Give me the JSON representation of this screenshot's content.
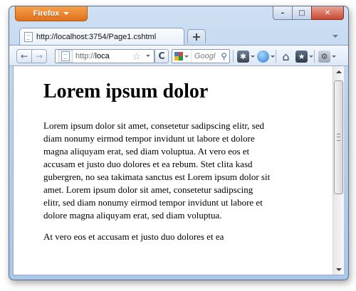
{
  "titlebar": {
    "app_menu_label": "Firefox",
    "minimize_glyph": "–",
    "maximize_glyph": "□",
    "close_glyph": "✕"
  },
  "tabs": [
    {
      "title": "http://localhost:3754/Page1.cshtml",
      "icon": "page-icon"
    }
  ],
  "new_tab_glyph": "+",
  "navigation": {
    "back_glyph": "←",
    "forward_glyph": "→",
    "url_host": "http://",
    "url_path": "loca",
    "reload_glyph": "C",
    "bookmark_star_glyph": "☆"
  },
  "search": {
    "placeholder": "Googl",
    "engine_icon": "google-icon",
    "go_glyph": "⚲"
  },
  "toolbar_icons": [
    "addon-bar-icon",
    "globe-icon",
    "home-icon",
    "bookmarks-icon",
    "extension-icon"
  ],
  "page": {
    "heading": "Lorem ipsum dolor",
    "paragraph1": "Lorem ipsum dolor sit amet, consetetur sadipscing elitr, sed diam nonumy eirmod tempor invidunt ut labore et dolore magna aliquyam erat, sed diam voluptua. At vero eos et accusam et justo duo dolores et ea rebum. Stet clita kasd gubergren, no sea takimata sanctus est Lorem ipsum dolor sit amet. Lorem ipsum dolor sit amet, consetetur sadipscing elitr, sed diam nonumy eirmod tempor invidunt ut labore et dolore magna aliquyam erat, sed diam voluptua.",
    "paragraph2": "At vero eos et accusam et justo duo dolores et ea"
  },
  "colors": {
    "firefox_orange": "#e0701c",
    "window_frame": "#b9d1ec",
    "close_red": "#c94a33"
  }
}
